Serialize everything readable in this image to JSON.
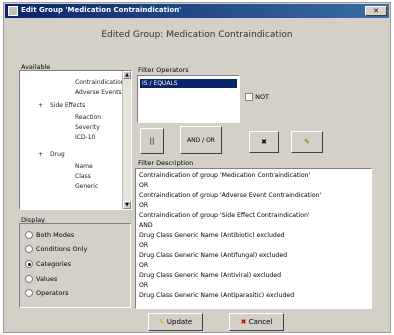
{
  "window": {
    "title": "Edit Group 'Medication Contraindication'",
    "close_label": "✕"
  },
  "heading": "Edited Group: Medication Contraindication",
  "tree": {
    "label": "Available",
    "rows": [
      "Contraindications",
      "Adverse Events",
      "Side Effects",
      "Reaction",
      "Severity",
      "ICD-10",
      "Drug",
      "Name",
      "Class",
      "Generic"
    ]
  },
  "filter": {
    "label": "Filter Operators",
    "items": [
      "IS / EQUALS"
    ],
    "not_label": "NOT"
  },
  "toolbar": {
    "pause_label": "||",
    "add_label": "AND / OR",
    "delete_label": "✖",
    "tool_label": "✎"
  },
  "filter_description": {
    "label": "Filter Description",
    "lines": [
      "Contraindication of group 'Medication Contraindication'",
      "OR",
      "Contraindication of group 'Adverse Event Contraindication'",
      "OR",
      "Contraindication of group 'Side Effect Contraindication'",
      "AND",
      "Drug Class Generic Name (Antibiotic) excluded",
      "OR",
      "Drug Class Generic Name (Antifungal) excluded",
      "OR",
      "Drug Class Generic Name (Antiviral) excluded",
      "OR",
      "Drug Class Generic Name (Antiparasitic) excluded"
    ]
  },
  "options": {
    "label": "Display",
    "items": [
      {
        "label": "Both Modes",
        "checked": false
      },
      {
        "label": "Conditions Only",
        "checked": false
      },
      {
        "label": "Categories",
        "checked": true
      },
      {
        "label": "Values",
        "checked": false
      },
      {
        "label": "Operators",
        "checked": false
      }
    ]
  },
  "buttons": {
    "update_label": "Update",
    "cancel_label": "Cancel"
  },
  "colors": {
    "titlebar": "#0a246a",
    "selection": "#0a246a",
    "window_bg": "#d4d0c8"
  }
}
